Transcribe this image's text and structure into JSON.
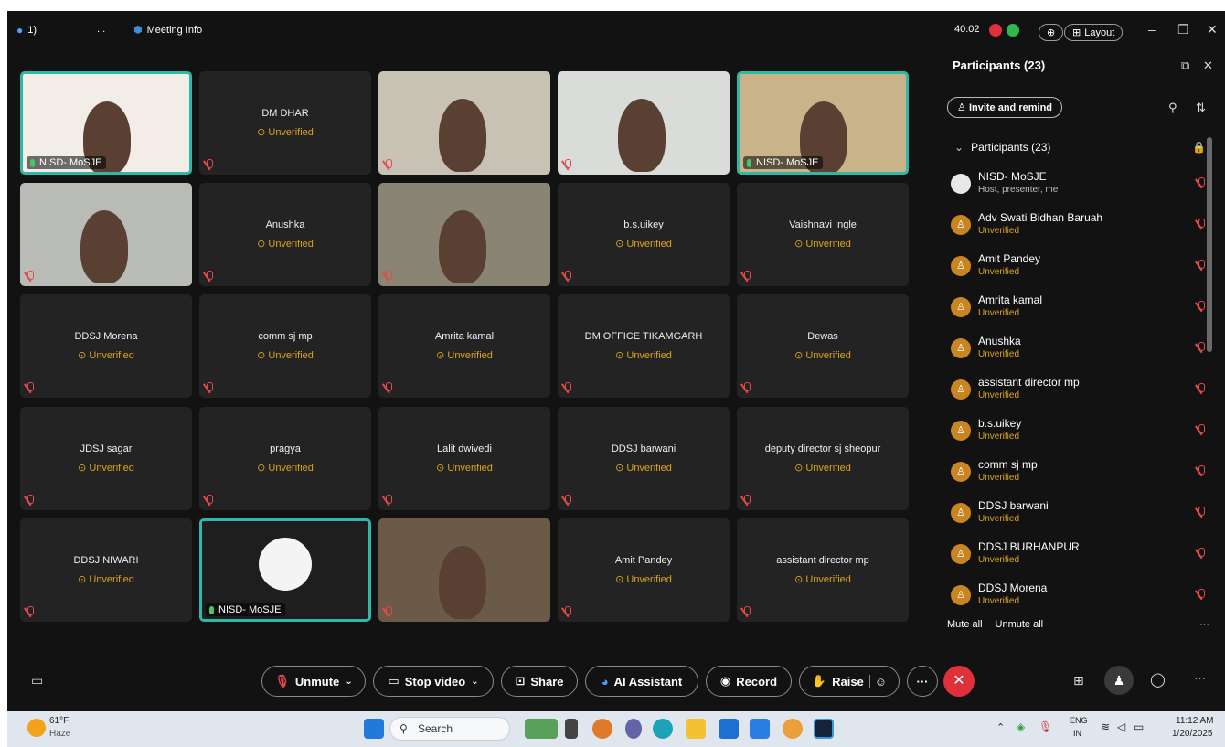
{
  "topbar": {
    "count_badge": "1)",
    "more": "...",
    "meeting_info": "Meeting Info",
    "timer": "40:02",
    "layout": "Layout"
  },
  "tiles": [
    {
      "name": "NISD- MoSJE",
      "video": true
    },
    {
      "name": "DM DHAR",
      "status": "Unverified"
    },
    {
      "name": "",
      "video": true
    },
    {
      "name": "",
      "video": true
    },
    {
      "name": "NISD- MoSJE",
      "video": true
    },
    {
      "name": "",
      "video": true
    },
    {
      "name": "Anushka",
      "status": "Unverified"
    },
    {
      "name": "",
      "video": true
    },
    {
      "name": "b.s.uikey",
      "status": "Unverified"
    },
    {
      "name": "Vaishnavi Ingle",
      "status": "Unverified"
    },
    {
      "name": "DDSJ Morena",
      "status": "Unverified"
    },
    {
      "name": "comm sj mp",
      "status": "Unverified"
    },
    {
      "name": "Amrita kamal",
      "status": "Unverified"
    },
    {
      "name": "DM OFFICE TIKAMGARH",
      "status": "Unverified"
    },
    {
      "name": "Dewas",
      "status": "Unverified"
    },
    {
      "name": "JDSJ sagar",
      "status": "Unverified"
    },
    {
      "name": "pragya",
      "status": "Unverified"
    },
    {
      "name": "Lalit dwivedi",
      "status": "Unverified"
    },
    {
      "name": "DDSJ barwani",
      "status": "Unverified"
    },
    {
      "name": "deputy director sj sheopur",
      "status": "Unverified"
    },
    {
      "name": "DDSJ NIWARI",
      "status": "Unverified"
    },
    {
      "name": "NISD- MoSJE",
      "video": true
    },
    {
      "name": "",
      "video": true
    },
    {
      "name": "Amit Pandey",
      "status": "Unverified"
    },
    {
      "name": "assistant director mp",
      "status": "Unverified"
    }
  ],
  "panel": {
    "title": "Participants (23)",
    "invite": "Invite and remind",
    "list_header": "Participants (23)",
    "participants": [
      {
        "name": "NISD- MoSJE",
        "sub": "Host, presenter, me",
        "host": true
      },
      {
        "name": "Adv Swati Bidhan Baruah",
        "sub": "Unverified"
      },
      {
        "name": "Amit Pandey",
        "sub": "Unverified"
      },
      {
        "name": "Amrita kamal",
        "sub": "Unverified"
      },
      {
        "name": "Anushka",
        "sub": "Unverified"
      },
      {
        "name": "assistant director mp",
        "sub": "Unverified"
      },
      {
        "name": "b.s.uikey",
        "sub": "Unverified"
      },
      {
        "name": "comm sj mp",
        "sub": "Unverified"
      },
      {
        "name": "DDSJ barwani",
        "sub": "Unverified"
      },
      {
        "name": "DDSJ BURHANPUR",
        "sub": "Unverified"
      },
      {
        "name": "DDSJ Morena",
        "sub": "Unverified"
      }
    ],
    "mute_all": "Mute all",
    "unmute_all": "Unmute all"
  },
  "toolbar": {
    "unmute": "Unmute",
    "stop_video": "Stop video",
    "share": "Share",
    "ai_assistant": "AI Assistant",
    "record": "Record",
    "raise": "Raise"
  },
  "taskbar": {
    "temp": "61°F",
    "weather": "Haze",
    "search": "Search",
    "lang1": "ENG",
    "lang2": "IN",
    "time": "11:12 AM",
    "date": "1/20/2025"
  }
}
